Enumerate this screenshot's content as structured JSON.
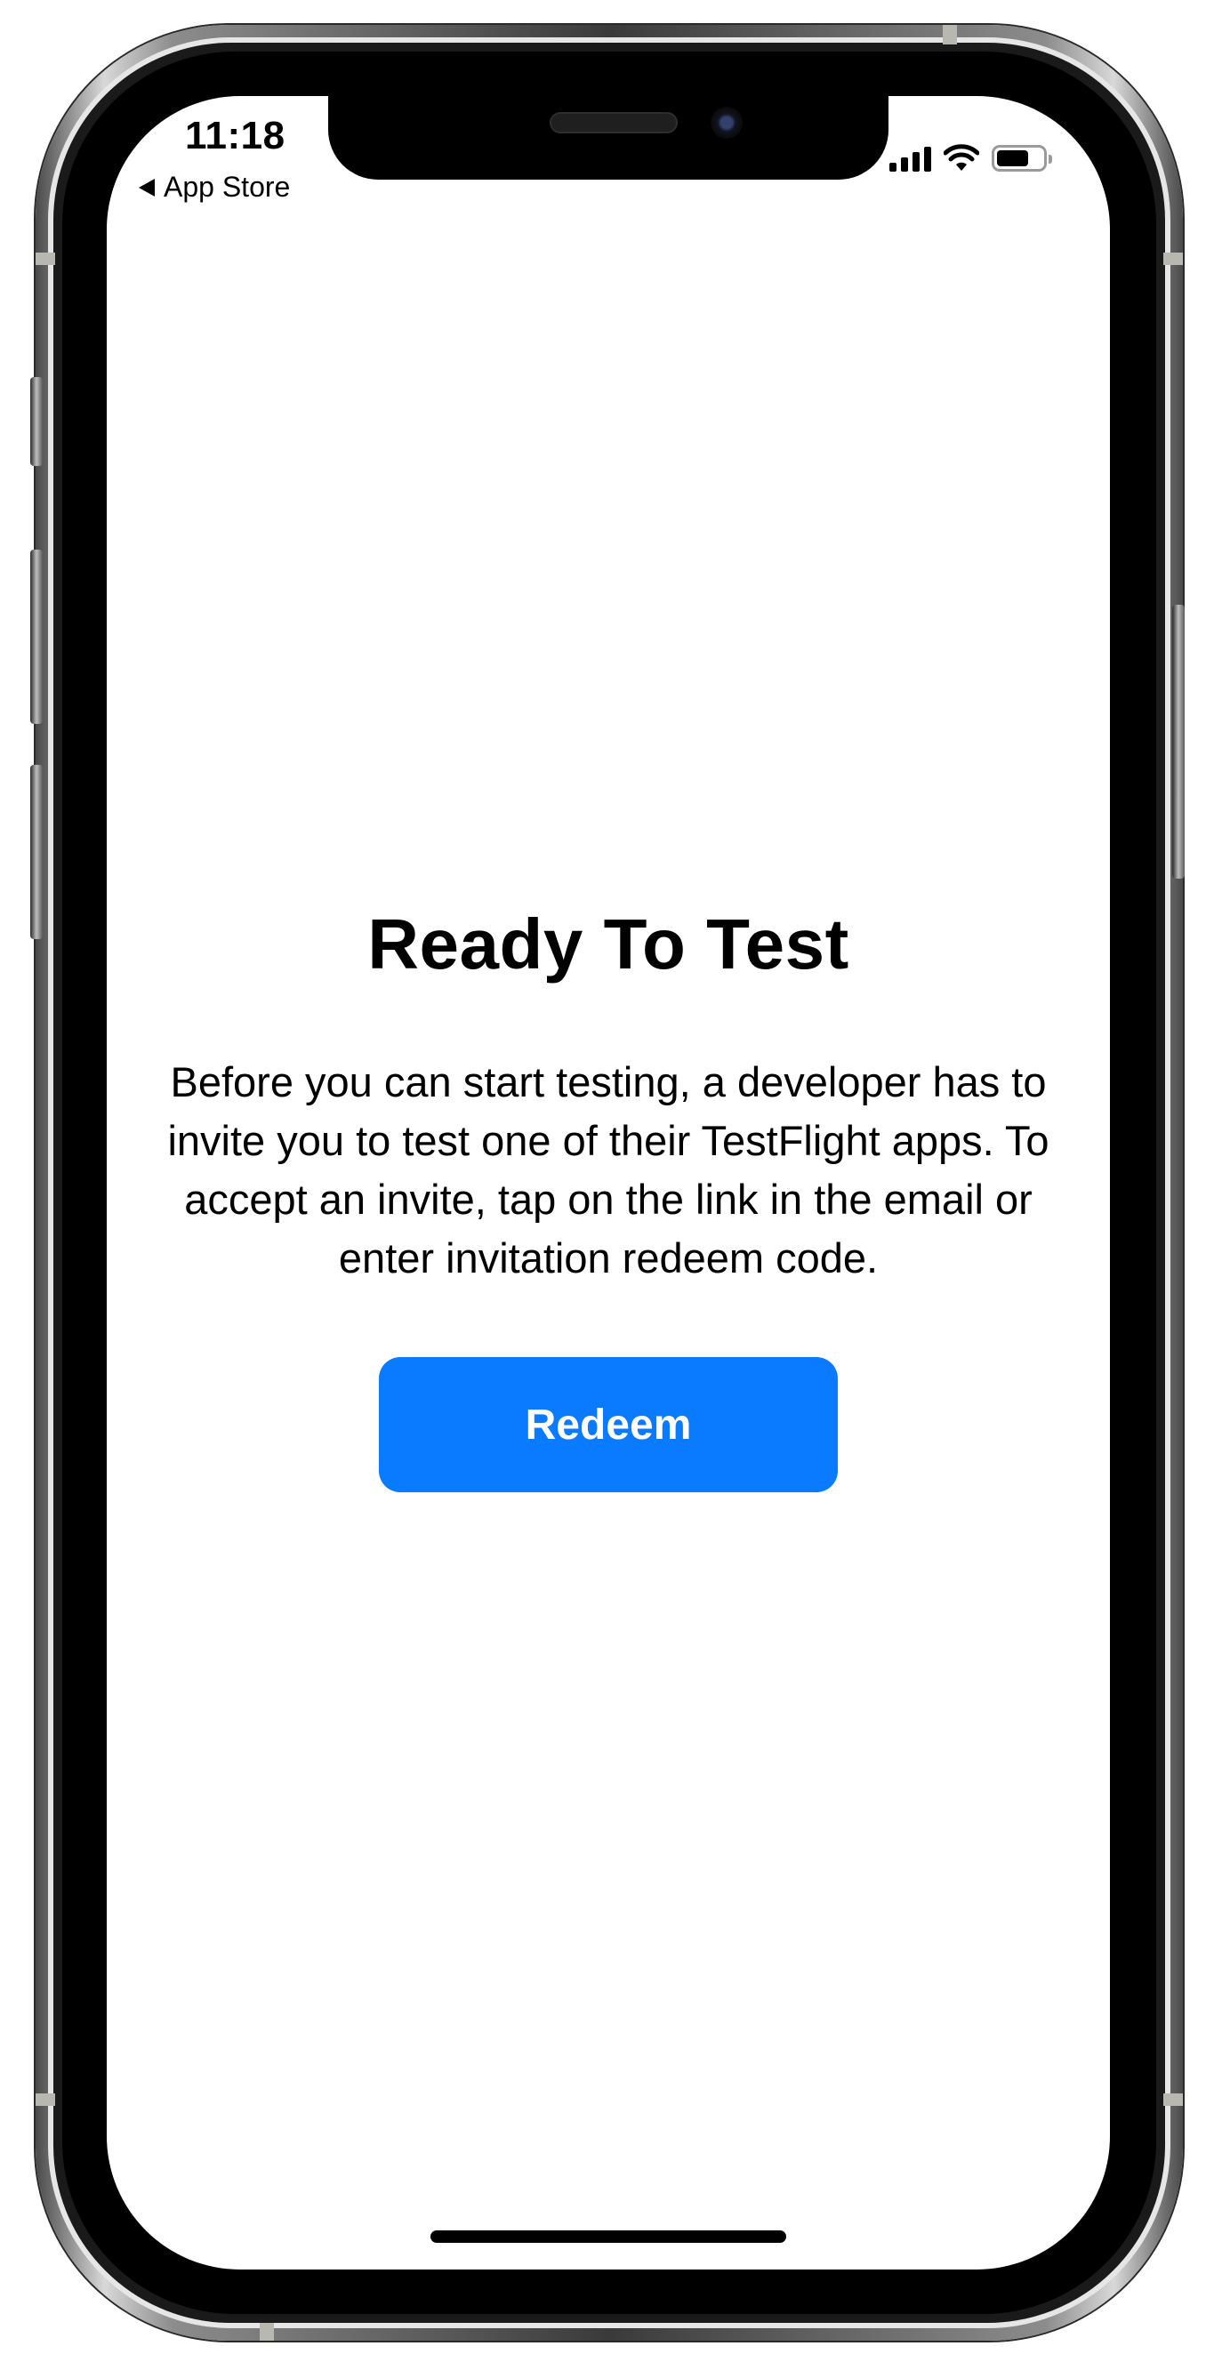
{
  "status_bar": {
    "time": "11:18",
    "back_label": "App Store",
    "icons": [
      "cellular-signal-icon",
      "wifi-icon",
      "battery-icon"
    ]
  },
  "main": {
    "title": "Ready To Test",
    "description": "Before you can start testing, a developer has to invite you to test one of their TestFlight apps. To accept an invite, tap on the link in the email or enter invitation redeem code.",
    "redeem_label": "Redeem"
  },
  "colors": {
    "accent": "#0a7aff",
    "background": "#ffffff",
    "text": "#000000"
  }
}
